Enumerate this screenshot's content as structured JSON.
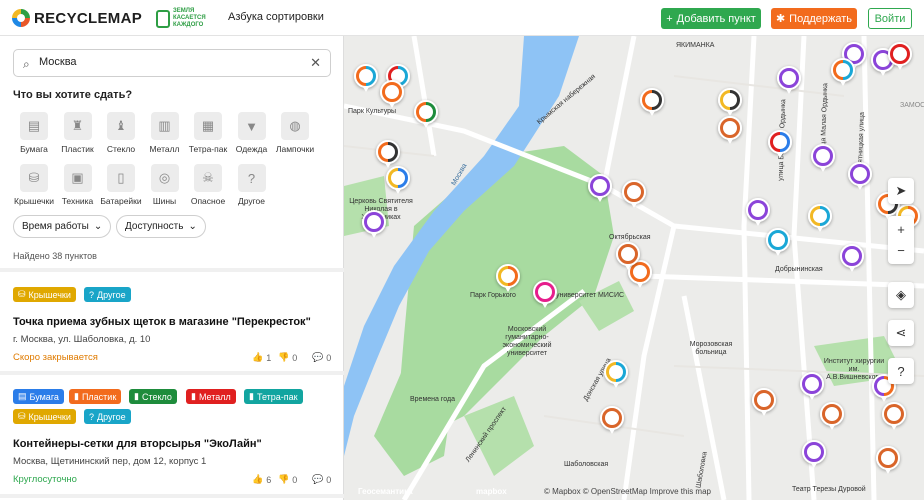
{
  "header": {
    "logo": "RECYCLEMAP",
    "partner": "ЗЕМЛЯ КАСАЕТСЯ КАЖДОГО",
    "nav_link": "Азбука сортировки",
    "add_button": "Добавить пункт",
    "support_button": "Поддержать",
    "login_button": "Войти"
  },
  "search": {
    "value": "Москва"
  },
  "question": "Что вы хотите сдать?",
  "categories": [
    {
      "label": "Бумага",
      "icon": "paper-icon"
    },
    {
      "label": "Пластик",
      "icon": "plastic-bottle-icon"
    },
    {
      "label": "Стекло",
      "icon": "glass-bottle-icon"
    },
    {
      "label": "Металл",
      "icon": "metal-can-icon"
    },
    {
      "label": "Тетра-пак",
      "icon": "tetra-pak-icon"
    },
    {
      "label": "Одежда",
      "icon": "clothes-icon"
    },
    {
      "label": "Лампочки",
      "icon": "bulb-icon"
    },
    {
      "label": "Крышечки",
      "icon": "caps-icon"
    },
    {
      "label": "Техника",
      "icon": "appliance-icon"
    },
    {
      "label": "Батарейки",
      "icon": "battery-icon"
    },
    {
      "label": "Шины",
      "icon": "tire-icon"
    },
    {
      "label": "Опасное",
      "icon": "hazard-icon"
    },
    {
      "label": "Другое",
      "icon": "question-icon"
    }
  ],
  "filters": {
    "hours": "Время работы",
    "access": "Доступность"
  },
  "found": "Найдено 38 пунктов",
  "cards": [
    {
      "tags": [
        {
          "label": "Крышечки",
          "color": "#e0a800"
        },
        {
          "label": "Другое",
          "color": "#19a5c8"
        }
      ],
      "title": "Точка приема зубных щеток в магазине \"Перекресток\"",
      "address": "г. Москва, ул. Шаболовка, д. 10",
      "status": "Скоро закрывается",
      "status_color": "#e07b00",
      "likes": "1",
      "dislikes": "0",
      "comments": "0"
    },
    {
      "tags": [
        {
          "label": "Бумага",
          "color": "#2b7de9"
        },
        {
          "label": "Пластик",
          "color": "#f26b1d"
        },
        {
          "label": "Стекло",
          "color": "#1e8c3c"
        },
        {
          "label": "Металл",
          "color": "#e02020"
        },
        {
          "label": "Тетра-пак",
          "color": "#12a5a0"
        },
        {
          "label": "Крышечки",
          "color": "#e0a800"
        },
        {
          "label": "Другое",
          "color": "#19a5c8"
        }
      ],
      "title": "Контейнеры-сетки для вторсырья \"ЭкоЛайн\"",
      "address": "Москва, Щетининский пер, дом 12, корпус 1",
      "status": "Круглосуточно",
      "status_color": "#2fa84f",
      "likes": "6",
      "dislikes": "0",
      "comments": "0"
    }
  ],
  "map": {
    "labels": [
      "ЯКИМАНКА",
      "Парк Культуры",
      "Октябрьская",
      "Добрынинская",
      "Шаболовская",
      "Парк Горького",
      "университет МИСИС",
      "Московский гуманитарно-экономический университет",
      "Морозовская больница",
      "Институт хирургии им. А.В.Вишневского",
      "Театр Терезы Дуровой",
      "Времена года",
      "Церковь Святителя Николая в Хамовниках",
      "Москва",
      "Крымская набережная",
      "Ленинский проспект",
      "улица Большая Ордынка",
      "улица Малая Ордынка",
      "Пятницкая улица",
      "Донская улица",
      "Шаболовка",
      "ЗАМОС"
    ],
    "attribution": "© Mapbox © OpenStreetMap Improve this map",
    "brand": "mapbox",
    "brand2": "Геосемантика"
  }
}
